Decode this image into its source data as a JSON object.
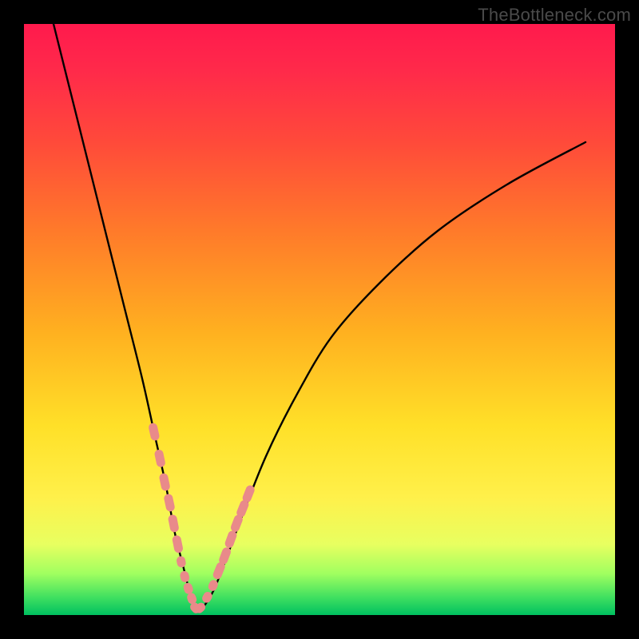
{
  "attribution": "TheBottleneck.com",
  "chart_data": {
    "type": "line",
    "title": "",
    "xlabel": "",
    "ylabel": "",
    "xlim": [
      0,
      100
    ],
    "ylim": [
      0,
      100
    ],
    "grid": false,
    "series": [
      {
        "name": "bottleneck-curve",
        "x": [
          5,
          8,
          11,
          14,
          17,
          20,
          22,
          24,
          25.5,
          27,
          28,
          29,
          30,
          32,
          34,
          37,
          41,
          46,
          52,
          60,
          70,
          82,
          95
        ],
        "y": [
          100,
          88,
          76,
          64,
          52,
          40,
          31,
          22,
          14,
          8,
          4,
          1,
          1,
          4,
          9,
          17,
          27,
          37,
          47,
          56,
          65,
          73,
          80
        ]
      }
    ],
    "markers": {
      "name": "highlighted-points",
      "color": "#e98a8a",
      "x": [
        22.0,
        23.0,
        23.8,
        24.6,
        25.3,
        26.0,
        26.6,
        27.2,
        27.8,
        28.4,
        29.0,
        29.8,
        31.0,
        32.0,
        33.0,
        34.0,
        35.0,
        36.0,
        37.0,
        38.0
      ],
      "y": [
        31.0,
        26.5,
        22.5,
        19.0,
        15.5,
        12.0,
        9.0,
        6.5,
        4.5,
        2.8,
        1.2,
        1.2,
        3.0,
        5.0,
        7.5,
        10.0,
        12.8,
        15.5,
        18.0,
        20.5
      ]
    }
  }
}
